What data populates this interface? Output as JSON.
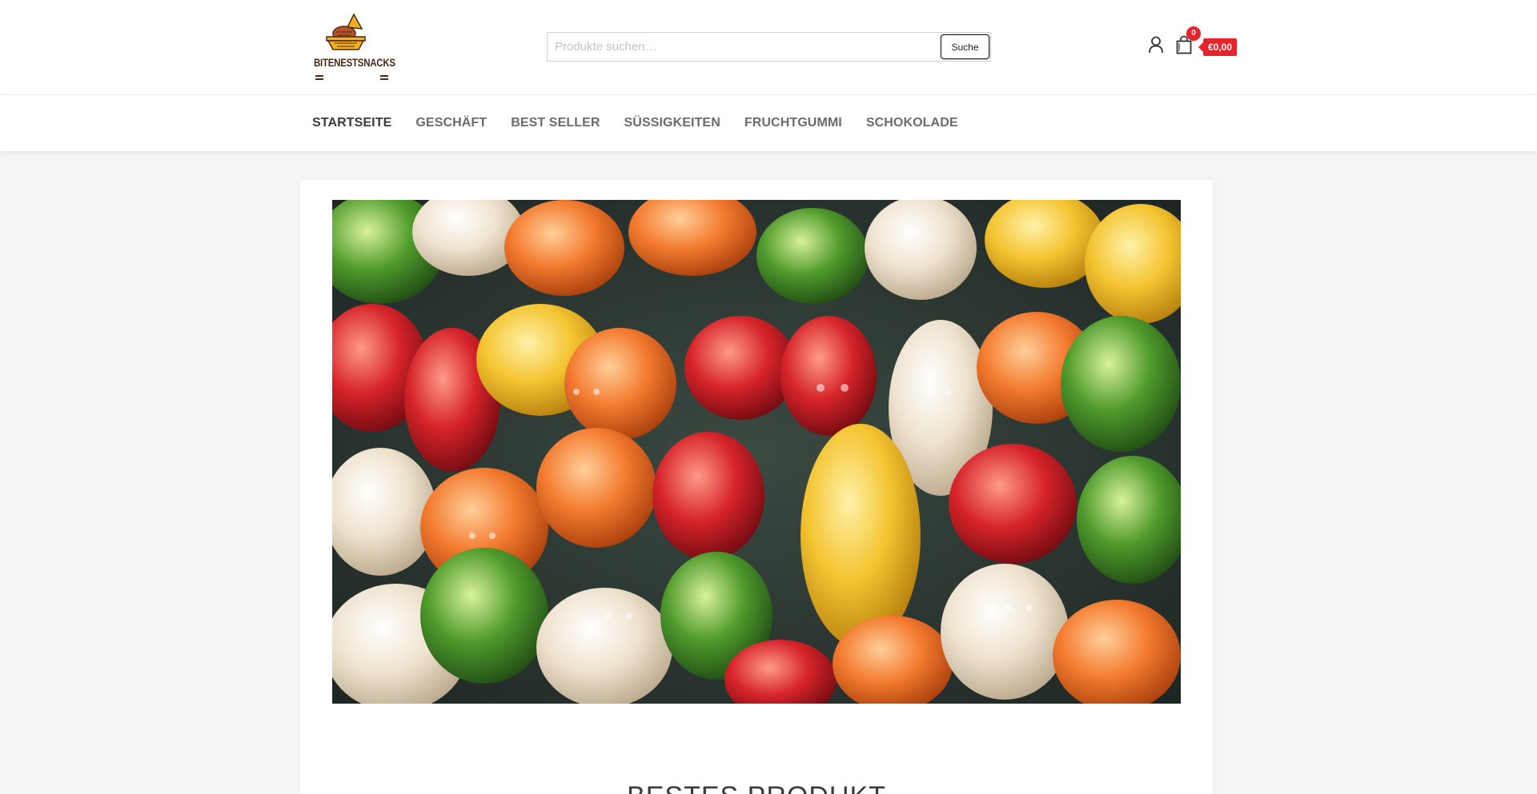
{
  "header": {
    "logo_text": "BITENESTSNACKS",
    "search": {
      "placeholder": "Produkte suchen…",
      "value": "",
      "button_label": "Suche"
    },
    "account_icon": "user-icon",
    "cart": {
      "icon": "shopping-bag-icon",
      "count": "0",
      "total": "€0,00"
    }
  },
  "nav": {
    "items": [
      {
        "label": "STARTSEITE",
        "active": true
      },
      {
        "label": "GESCHÄFT"
      },
      {
        "label": "BEST SELLER"
      },
      {
        "label": "SÜSSIGKEITEN"
      },
      {
        "label": "FRUCHTGUMMI"
      },
      {
        "label": "SCHOKOLADE"
      }
    ]
  },
  "main": {
    "hero_image": "gummy-bears-photo",
    "section_title": "BESTES PRODUKT"
  },
  "colors": {
    "accent_red": "#e8222a",
    "logo_brown": "#4a2a16",
    "logo_gold": "#f2b01e"
  }
}
